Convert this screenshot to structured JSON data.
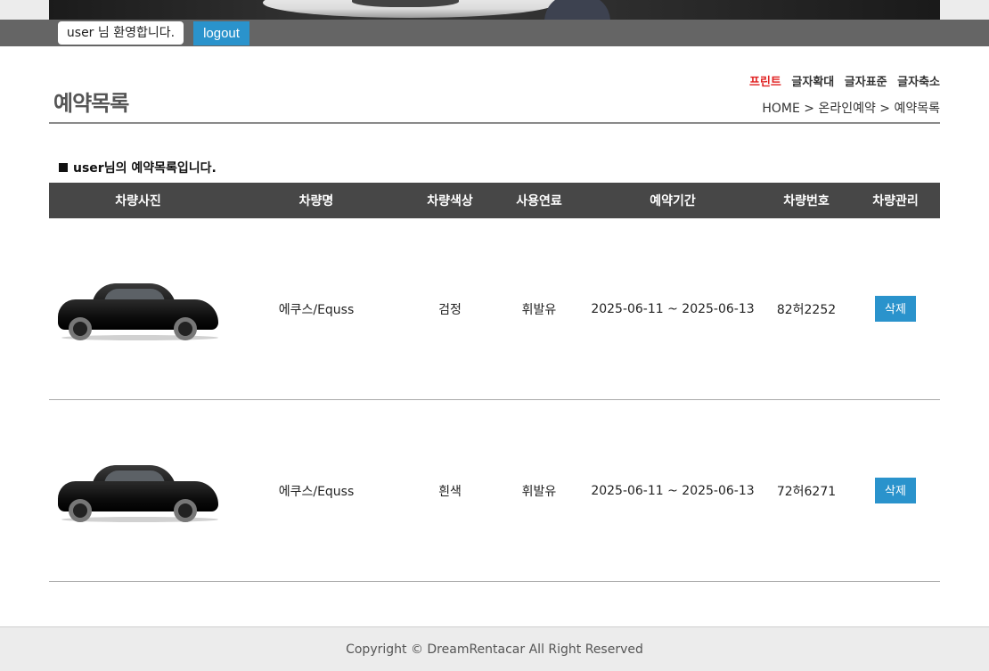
{
  "userbar": {
    "welcome": "user 님 환영합니다.",
    "logout": "logout"
  },
  "header": {
    "title": "예약목록",
    "tools": {
      "print": "프린트",
      "zoom_in": "글자확대",
      "zoom_reset": "글자표준",
      "zoom_out": "글자축소"
    },
    "breadcrumb": "HOME > 온라인예약 > 예약목록"
  },
  "caption": "user님의 예약목록입니다.",
  "table": {
    "headers": [
      "차량사진",
      "차량명",
      "차량색상",
      "사용연료",
      "예약기간",
      "차량번호",
      "차량관리"
    ],
    "rows": [
      {
        "name": "에쿠스/Equss",
        "color": "검정",
        "fuel": "휘발유",
        "period": "2025-06-11 ~ 2025-06-13",
        "plate": "82허2252",
        "action": "삭제"
      },
      {
        "name": "에쿠스/Equss",
        "color": "흰색",
        "fuel": "휘발유",
        "period": "2025-06-11 ~ 2025-06-13",
        "plate": "72허6271",
        "action": "삭제"
      }
    ]
  },
  "footer": "Copyright © DreamRentacar All Right Reserved"
}
